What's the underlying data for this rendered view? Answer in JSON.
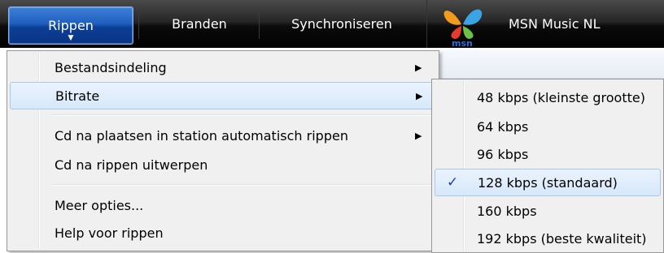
{
  "tabs": [
    {
      "label": "Rippen"
    },
    {
      "label": "Branden"
    },
    {
      "label": "Synchroniseren"
    },
    {
      "label": "MSN Music NL"
    }
  ],
  "msn_logo_text": "msn",
  "menu": {
    "items": [
      {
        "label": "Bestandsindeling",
        "has_submenu": true
      },
      {
        "label": "Bitrate",
        "has_submenu": true,
        "highlighted": true
      },
      {
        "label": "Cd na plaatsen in station automatisch rippen",
        "has_submenu": true
      },
      {
        "label": "Cd na rippen uitwerpen"
      },
      {
        "label": "Meer opties..."
      },
      {
        "label": "Help voor rippen"
      }
    ]
  },
  "submenu": {
    "items": [
      {
        "label": "48 kbps (kleinste grootte)"
      },
      {
        "label": "64 kbps"
      },
      {
        "label": "96 kbps"
      },
      {
        "label": "128 kbps (standaard)",
        "checked": true
      },
      {
        "label": "160 kbps"
      },
      {
        "label": "192 kbps (beste kwaliteit)"
      }
    ],
    "check_glyph": "✓"
  },
  "glyphs": {
    "submenu_arrow": "▶",
    "tab_chevron": "▼"
  },
  "colors": {
    "accent": "#1f5fbf",
    "checkmark": "#1d3fa5"
  }
}
